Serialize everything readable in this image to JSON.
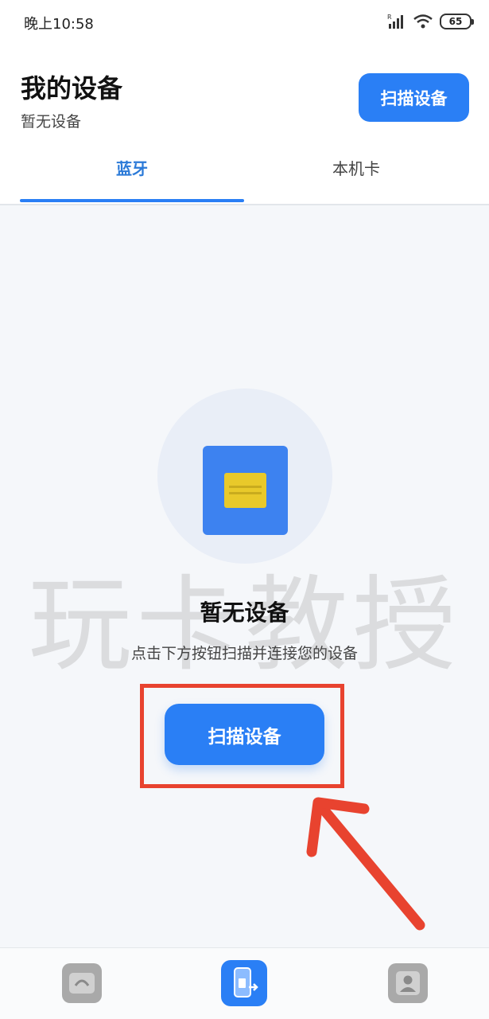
{
  "status_bar": {
    "time": "晚上10:58",
    "battery": "65"
  },
  "header": {
    "title": "我的设备",
    "subtitle": "暂无设备",
    "scan_button": "扫描设备"
  },
  "tabs": [
    {
      "label": "蓝牙",
      "active": true
    },
    {
      "label": "本机卡",
      "active": false
    }
  ],
  "empty_state": {
    "icon": "sim-card-icon",
    "title": "暂无设备",
    "description": "点击下方按钮扫描并连接您的设备",
    "scan_button": "扫描设备"
  },
  "watermark": "玩卡教授",
  "bottom_nav": [
    {
      "icon": "home-icon"
    },
    {
      "icon": "device-icon",
      "active": true
    },
    {
      "icon": "profile-icon"
    }
  ],
  "colors": {
    "accent": "#2a7ff5",
    "active_tab_text": "#2b7ad8",
    "annotation_red": "#e8432f",
    "chip_yellow": "#e9c92a",
    "nav_inactive": "#a9a9a9"
  }
}
